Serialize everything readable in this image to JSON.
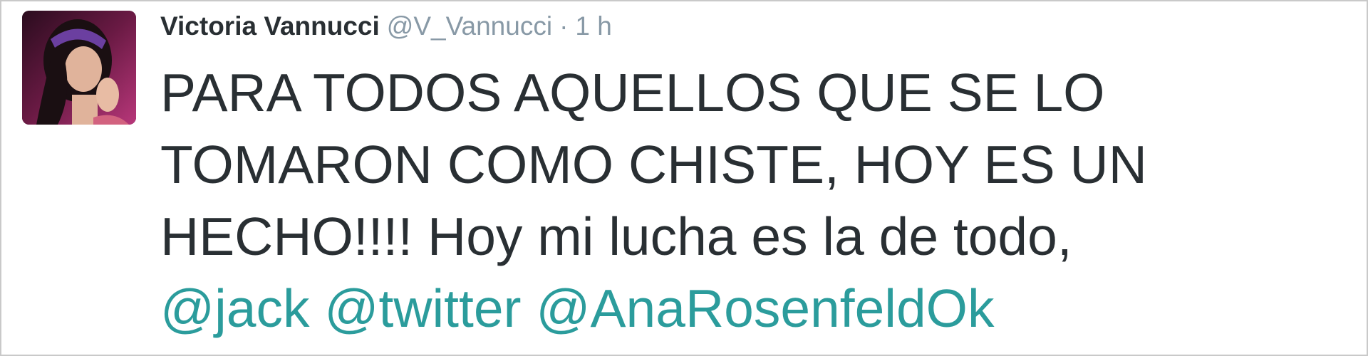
{
  "tweet": {
    "display_name": "Victoria Vannucci",
    "handle": "@V_Vannucci",
    "separator": "·",
    "time": "1 h",
    "text_lines": [
      "PARA TODOS AQUELLOS QUE SE LO",
      "TOMARON COMO CHISTE, HOY ES UN",
      "HECHO!!!! Hoy mi lucha es la de todo,"
    ],
    "mentions": [
      "@jack",
      "@twitter",
      "@AnaRosenfeldOk"
    ]
  },
  "colors": {
    "text": "#292f33",
    "meta": "#8899a6",
    "mention": "#2b9c9c",
    "border": "#c9c9c9"
  }
}
